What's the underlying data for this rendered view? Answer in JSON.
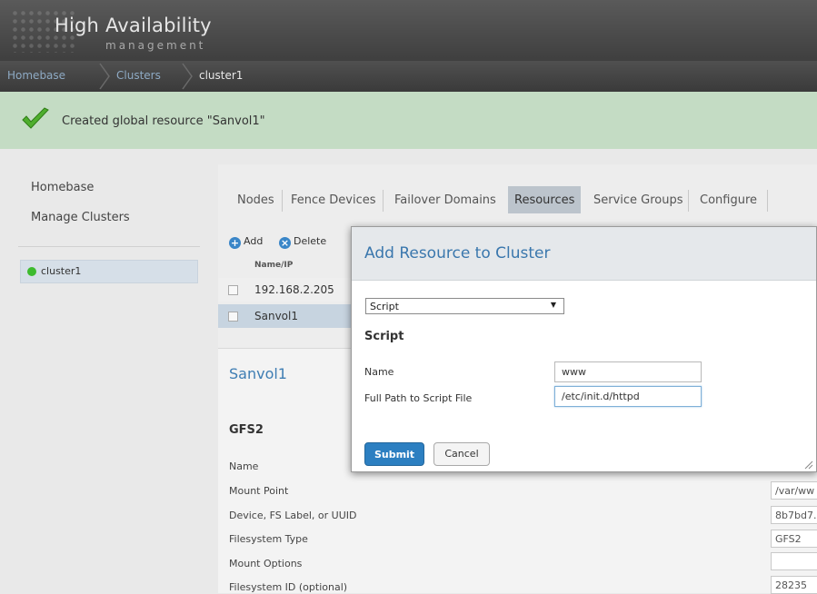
{
  "app": {
    "title": "High Availability",
    "subtitle": "management"
  },
  "breadcrumb": {
    "items": [
      "Homebase",
      "Clusters",
      "cluster1"
    ]
  },
  "notification": {
    "message": "Created global resource \"Sanvol1\""
  },
  "sidebar": {
    "links": [
      "Homebase",
      "Manage Clusters"
    ],
    "clusters": [
      {
        "name": "cluster1",
        "status_color": "#3dbb2f"
      }
    ]
  },
  "tabs": [
    "Nodes",
    "Fence Devices",
    "Failover Domains",
    "Resources",
    "Service Groups",
    "Configure"
  ],
  "active_tab": "Resources",
  "toolbar": {
    "add_label": "Add",
    "delete_label": "Delete"
  },
  "resource_table": {
    "column": "Name/IP",
    "rows": [
      "192.168.2.205",
      "Sanvol1"
    ],
    "selected": "Sanvol1"
  },
  "resource_detail": {
    "title": "Sanvol1",
    "type_heading": "GFS2",
    "fields": [
      {
        "label": "Name",
        "value": ""
      },
      {
        "label": "Mount Point",
        "value": "/var/ww"
      },
      {
        "label": "Device, FS Label, or UUID",
        "value": "8b7bd7."
      },
      {
        "label": "Filesystem Type",
        "value": "GFS2"
      },
      {
        "label": "Mount Options",
        "value": ""
      },
      {
        "label": "Filesystem ID (optional)",
        "value": "28235"
      }
    ]
  },
  "modal": {
    "title": "Add Resource to Cluster",
    "resource_type": "Script",
    "section_heading": "Script",
    "fields": [
      {
        "label": "Name",
        "value": "www"
      },
      {
        "label": "Full Path to Script File",
        "value": "/etc/init.d/httpd"
      }
    ],
    "submit_label": "Submit",
    "cancel_label": "Cancel"
  },
  "colors": {
    "accent": "#3a77ad",
    "success_bg": "#c4dcc4",
    "header_bg": "#4a4a4a"
  }
}
